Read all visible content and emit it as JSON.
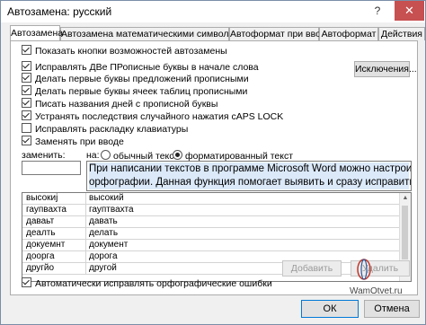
{
  "window": {
    "title": "Автозамена: русский",
    "help_glyph": "?",
    "close_glyph": "✕"
  },
  "tabs": [
    {
      "label": "Автозамена"
    },
    {
      "label": "Автозамена математическими символами"
    },
    {
      "label": "Автоформат при вводе"
    },
    {
      "label": "Автоформат"
    },
    {
      "label": "Действия"
    }
  ],
  "options": {
    "show_buttons": "Показать кнопки возможностей автозамены",
    "fix_two_caps": "Исправлять ДВе ПРописные буквы в начале слова",
    "capitalize_sentence": "Делать первые буквы предложений прописными",
    "capitalize_table": "Делать первые буквы ячеек таблиц прописными",
    "capitalize_days": "Писать названия дней с прописной буквы",
    "fix_caps_lock": "Устранять последствия случайного нажатия cAPS LOCK",
    "fix_keyboard": "Исправлять раскладку клавиатуры",
    "replace_as_type": "Заменять при вводе"
  },
  "buttons": {
    "exceptions": "Исключения...",
    "add": "Добавить",
    "delete": "Удалить",
    "ok": "ОК",
    "cancel": "Отмена"
  },
  "replace": {
    "replace_label": "заменить:",
    "with_label": "на:",
    "plain_text": "обычный текст",
    "formatted_text": "форматированный текст",
    "replace_value": "",
    "with_line1": "При написании текстов в программе Microsoft Word можно настроить автоматиче",
    "with_line2": "орфографии. Данная функция помогает выявить и сразу исправить ошибки в на"
  },
  "entries": [
    {
      "from": "высокиј",
      "to": "высокий"
    },
    {
      "from": "гаупвахта",
      "to": "гауптвахта"
    },
    {
      "from": "даваьт",
      "to": "давать"
    },
    {
      "from": "деалть",
      "to": "делать"
    },
    {
      "from": "докуемнт",
      "to": "документ"
    },
    {
      "from": "доорга",
      "to": "дорога"
    },
    {
      "from": "другйо",
      "to": "другой"
    }
  ],
  "auto_spell": "Автоматически исправлять орфографические ошибки",
  "watermark": "WamOtvet.ru"
}
